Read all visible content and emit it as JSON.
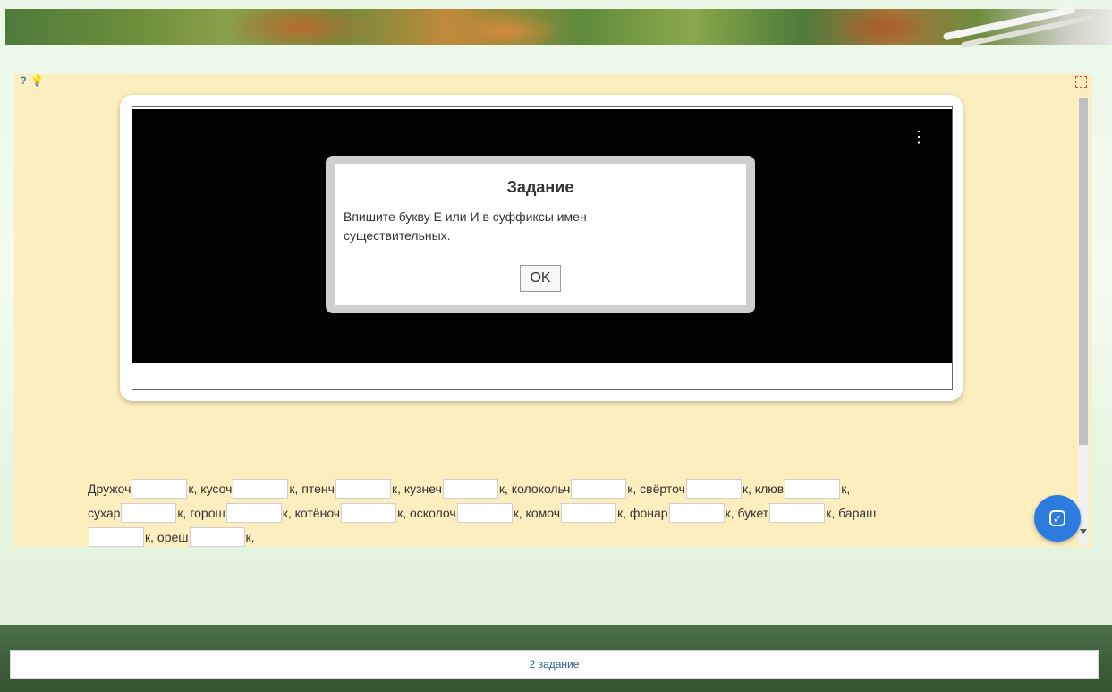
{
  "modal": {
    "title": "Задание",
    "text": "Впишите букву Е или И в суффиксы имен существительных.",
    "ok_label": "OK"
  },
  "exercise": {
    "line1": [
      "Дружоч",
      "к, кусоч",
      "к, птенч",
      "к, кузнеч",
      "к, колокольч",
      "к, свёрточ",
      "к, клюв",
      "к,"
    ],
    "line2": [
      "сухар",
      "к, горош",
      "к, котёноч",
      "к, осколоч",
      "к, комоч",
      "к, фонар",
      "к, букет",
      "к, бараш"
    ],
    "line3": [
      "",
      "к, ореш",
      "к."
    ]
  },
  "footer": {
    "task_label": "2 задание"
  },
  "icons": {
    "help": "help-icon",
    "hint": "lightbulb-icon",
    "fullscreen": "fullscreen-icon",
    "menu": "kebab-menu-icon",
    "check": "check-icon"
  },
  "colors": {
    "panel_bg": "#fdeec0",
    "check_button": "#2e7be0",
    "footer_link": "#2b5e97"
  }
}
